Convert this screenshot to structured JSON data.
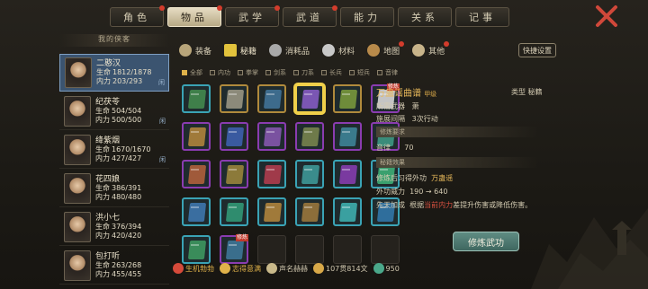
{
  "tabs": [
    {
      "label": "角色",
      "active": false,
      "dot": true
    },
    {
      "label": "物品",
      "active": true,
      "dot": true
    },
    {
      "label": "武学",
      "active": false,
      "dot": true
    },
    {
      "label": "武道",
      "active": false,
      "dot": true
    },
    {
      "label": "能力",
      "active": false,
      "dot": false
    },
    {
      "label": "关系",
      "active": false,
      "dot": false
    },
    {
      "label": "记事",
      "active": false,
      "dot": false
    }
  ],
  "team": {
    "title": "我的侠客",
    "heroes": [
      {
        "name": "二憨汉",
        "hp": "1812/1878",
        "mp": "203/293",
        "selected": true,
        "rank": "闲"
      },
      {
        "name": "纪茯苓",
        "hp": "504/504",
        "mp": "500/500",
        "selected": false,
        "rank": "闲"
      },
      {
        "name": "绛紫烟",
        "hp": "1670/1670",
        "mp": "427/427",
        "selected": false,
        "rank": "闲"
      },
      {
        "name": "花四娘",
        "hp": "386/391",
        "mp": "480/480",
        "selected": false,
        "rank": ""
      },
      {
        "name": "洪小七",
        "hp": "376/394",
        "mp": "420/420",
        "selected": false,
        "rank": ""
      },
      {
        "name": "包打听",
        "hp": "263/268",
        "mp": "455/455",
        "selected": false,
        "rank": ""
      }
    ],
    "hp_label": "生命",
    "mp_label": "内力"
  },
  "categories": [
    {
      "label": "装备",
      "active": false,
      "icon": "armor-icon"
    },
    {
      "label": "秘籍",
      "active": true,
      "icon": "book-icon"
    },
    {
      "label": "消耗品",
      "active": false,
      "icon": "potion-icon"
    },
    {
      "label": "材料",
      "active": false,
      "icon": "material-icon"
    },
    {
      "label": "地图",
      "active": false,
      "icon": "map-icon",
      "dot": true
    },
    {
      "label": "其他",
      "active": false,
      "icon": "misc-icon",
      "dot": true
    }
  ],
  "settings_label": "快捷设置",
  "filters": [
    {
      "label": "全部",
      "on": true
    },
    {
      "label": "内功",
      "on": false
    },
    {
      "label": "拳掌",
      "on": false
    },
    {
      "label": "剑系",
      "on": false
    },
    {
      "label": "刀系",
      "on": false
    },
    {
      "label": "长兵",
      "on": false
    },
    {
      "label": "短兵",
      "on": false
    },
    {
      "label": "音律",
      "on": false
    }
  ],
  "items": [
    {
      "frame": "#3aa3b5",
      "color": "#3f7f4a",
      "selected": false,
      "tag": ""
    },
    {
      "frame": "#b08a3c",
      "color": "#8c8a7a",
      "selected": false,
      "tag": ""
    },
    {
      "frame": "#b08a3c",
      "color": "#3d6b8c",
      "selected": false,
      "tag": ""
    },
    {
      "frame": "#e2c23c",
      "color": "#7a56b3",
      "selected": true,
      "tag": ""
    },
    {
      "frame": "#b08a3c",
      "color": "#6e8c3a",
      "selected": false,
      "tag": ""
    },
    {
      "frame": "#8a3cb0",
      "color": "#c4c4c4",
      "selected": false,
      "tag": "修炼"
    },
    {
      "frame": "#8a3cb0",
      "color": "#a07a3a",
      "selected": false,
      "tag": ""
    },
    {
      "frame": "#8a3cb0",
      "color": "#3a5aa0",
      "selected": false,
      "tag": ""
    },
    {
      "frame": "#8a3cb0",
      "color": "#7a52a0",
      "selected": false,
      "tag": ""
    },
    {
      "frame": "#8a3cb0",
      "color": "#6e7a4a",
      "selected": false,
      "tag": ""
    },
    {
      "frame": "#8a3cb0",
      "color": "#3a7a8c",
      "selected": false,
      "tag": ""
    },
    {
      "frame": "#8a3cb0",
      "color": "#3a8c7a",
      "selected": false,
      "tag": ""
    },
    {
      "frame": "#8a3cb0",
      "color": "#a05a3a",
      "selected": false,
      "tag": ""
    },
    {
      "frame": "#8a3cb0",
      "color": "#8c7a3a",
      "selected": false,
      "tag": ""
    },
    {
      "frame": "#3aa3b5",
      "color": "#a03a4a",
      "selected": false,
      "tag": ""
    },
    {
      "frame": "#3aa3b5",
      "color": "#3a8c8c",
      "selected": false,
      "tag": ""
    },
    {
      "frame": "#3aa3b5",
      "color": "#7a3aa0",
      "selected": false,
      "tag": ""
    },
    {
      "frame": "#3aa3b5",
      "color": "#3aa06e",
      "selected": false,
      "tag": ""
    },
    {
      "frame": "#3aa3b5",
      "color": "#3a6ea0",
      "selected": false,
      "tag": ""
    },
    {
      "frame": "#3aa3b5",
      "color": "#2f8c6e",
      "selected": false,
      "tag": ""
    },
    {
      "frame": "#3aa3b5",
      "color": "#a07a3a",
      "selected": false,
      "tag": ""
    },
    {
      "frame": "#3aa3b5",
      "color": "#8c6e3a",
      "selected": false,
      "tag": ""
    },
    {
      "frame": "#3aa3b5",
      "color": "#3aa0a0",
      "selected": false,
      "tag": ""
    },
    {
      "frame": "#3aa3b5",
      "color": "#2f6e9c",
      "selected": false,
      "tag": ""
    },
    {
      "frame": "#3aa3b5",
      "color": "#3a8c5a",
      "selected": false,
      "tag": ""
    },
    {
      "frame": "#8a3cb0",
      "color": "#3a6e8c",
      "selected": false,
      "tag": "修炼"
    },
    {
      "frame": "empty"
    },
    {
      "frame": "empty"
    },
    {
      "frame": "empty"
    },
    {
      "frame": "empty"
    }
  ],
  "detail": {
    "name": "万蛊谣曲谱",
    "grade": "甲级",
    "type_label": "类型",
    "type_value": "秘籍",
    "weapon_label": "所需武器",
    "weapon_value": "萧",
    "interval_label": "施展间隔",
    "interval_value": "3次行动",
    "req_section": "修炼要求",
    "req_label": "音律",
    "req_value": "70",
    "effect_section": "秘籍效果",
    "effect_line": "修炼后习得外功",
    "effect_skill": "万蛊谣",
    "power_label": "外功威力",
    "power_value": "190 → 640",
    "bonus_label": "先天加成",
    "bonus_text_a": "根据",
    "bonus_highlight": "当前内力",
    "bonus_text_b": "差提升伤害或降低伤害。",
    "learn_button": "修炼武功"
  },
  "bottom": [
    {
      "label": "生机勃勃",
      "icon": "heart-icon"
    },
    {
      "label": "志得意满",
      "icon": "smile-icon"
    },
    {
      "label": "声名赫赫",
      "icon": "fame-icon"
    },
    {
      "label": "107贯814文",
      "icon": "coin-icon"
    },
    {
      "label": "950",
      "icon": "jade-icon"
    }
  ]
}
